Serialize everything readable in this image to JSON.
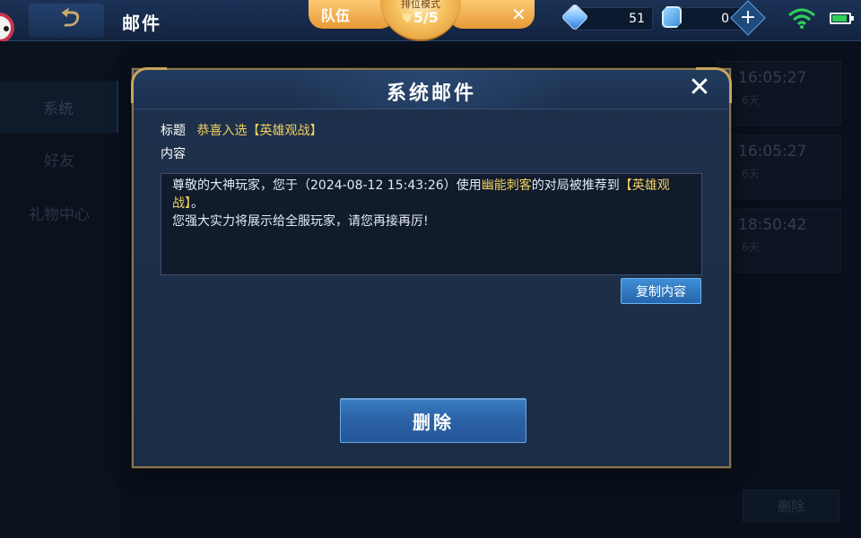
{
  "header": {
    "title": "邮件",
    "team_label": "队伍",
    "rank_mode_label": "排位模式",
    "rank_count": "5/5",
    "diamond_value": "51",
    "voucher_value": "0"
  },
  "sidebar": {
    "items": [
      {
        "label": "系统",
        "active": true
      },
      {
        "label": "好友",
        "active": false
      },
      {
        "label": "礼物中心",
        "active": false
      }
    ]
  },
  "mail_list": [
    {
      "time": "16:05:27",
      "age": "6天"
    },
    {
      "time": "16:05:27",
      "age": "6天"
    },
    {
      "time": "18:50:42",
      "age": "6天"
    }
  ],
  "background_delete_label": "删除",
  "dialog": {
    "title": "系统邮件",
    "subject_label": "标题",
    "subject": "恭喜入选【英雄观战】",
    "content_label": "内容",
    "body": {
      "part1": "尊敬的大神玩家，您于（2024-08-12 15:43:26）使用",
      "hero": "幽能刺客",
      "part2": "的对局被推荐到",
      "feature": "【英雄观战】",
      "part3": "。",
      "line2": "您强大实力将展示给全服玩家，请您再接再厉!"
    },
    "copy_button": "复制内容",
    "delete_button": "删除"
  },
  "colors": {
    "highlight": "#f0d060",
    "dialog_border": "#c9a45c",
    "button_blue": "#2a62a4"
  },
  "icons": [
    "back-icon",
    "rank-shield-icon",
    "close-icon",
    "diamond-icon",
    "voucher-icon",
    "add-icon",
    "wifi-icon",
    "battery-icon"
  ]
}
